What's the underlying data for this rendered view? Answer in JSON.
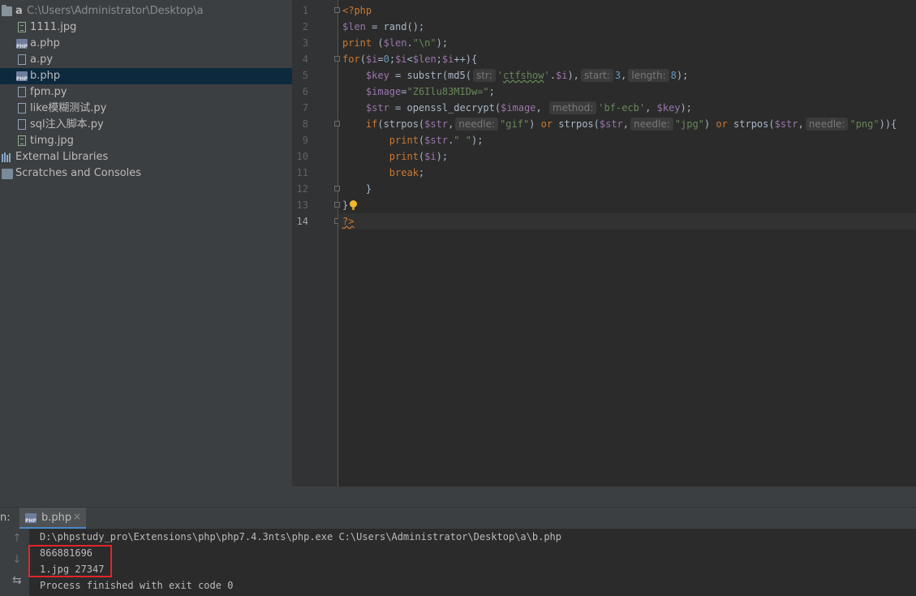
{
  "project": {
    "root_name": "a",
    "root_path": "C:\\Users\\Administrator\\Desktop\\a",
    "files": [
      {
        "name": "1111.jpg",
        "icon": "image-file-icon"
      },
      {
        "name": "a.php",
        "icon": "php-file-icon"
      },
      {
        "name": "a.py",
        "icon": "python-file-icon"
      },
      {
        "name": "b.php",
        "icon": "php-file-icon",
        "selected": true
      },
      {
        "name": "fpm.py",
        "icon": "python-file-icon"
      },
      {
        "name": "like模糊测试.py",
        "icon": "python-file-icon"
      },
      {
        "name": "sql注入脚本.py",
        "icon": "python-file-icon"
      },
      {
        "name": "timg.jpg",
        "icon": "image-file-icon"
      }
    ],
    "external_libraries": "External Libraries",
    "scratches": "Scratches and Consoles",
    "php_icon_text": "PHP"
  },
  "editor": {
    "line_numbers": [
      "1",
      "2",
      "3",
      "4",
      "5",
      "6",
      "7",
      "8",
      "9",
      "10",
      "11",
      "12",
      "13",
      "14"
    ],
    "active_line": "14",
    "hints": {
      "str": "str:",
      "start": "start:",
      "length": "length:",
      "method": "method:",
      "needle": "needle:"
    }
  },
  "run": {
    "label": "n:",
    "tab_label": "b.php",
    "close": "×",
    "command": "D:\\phpstudy_pro\\Extensions\\php\\php7.4.3nts\\php.exe C:\\Users\\Administrator\\Desktop\\a\\b.php",
    "output_lines": [
      "866881696",
      "1.jpg 27347"
    ],
    "finished": "Process finished with exit code 0"
  },
  "colors": {
    "selection": "#0d293e",
    "highlight_box": "#e0262a",
    "keyword": "#cc7832",
    "variable": "#9876aa",
    "string": "#6a8759",
    "number": "#6897bb"
  }
}
